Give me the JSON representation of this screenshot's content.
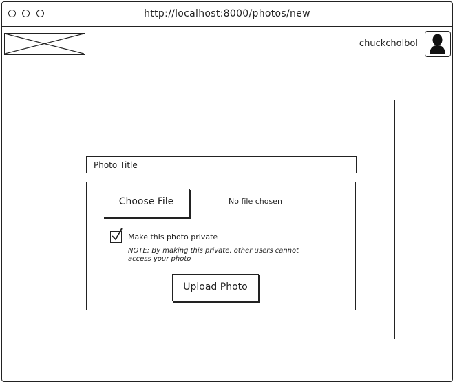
{
  "browser": {
    "url": "http://localhost:8000/photos/new"
  },
  "header": {
    "username": "chuckcholbol"
  },
  "form": {
    "title_placeholder": "Photo Title",
    "choose_file_label": "Choose File",
    "no_file_text": "No file chosen",
    "private_label": "Make this photo private",
    "private_checked": true,
    "note": "NOTE: By making this private, other users cannot access your photo",
    "upload_label": "Upload Photo"
  }
}
